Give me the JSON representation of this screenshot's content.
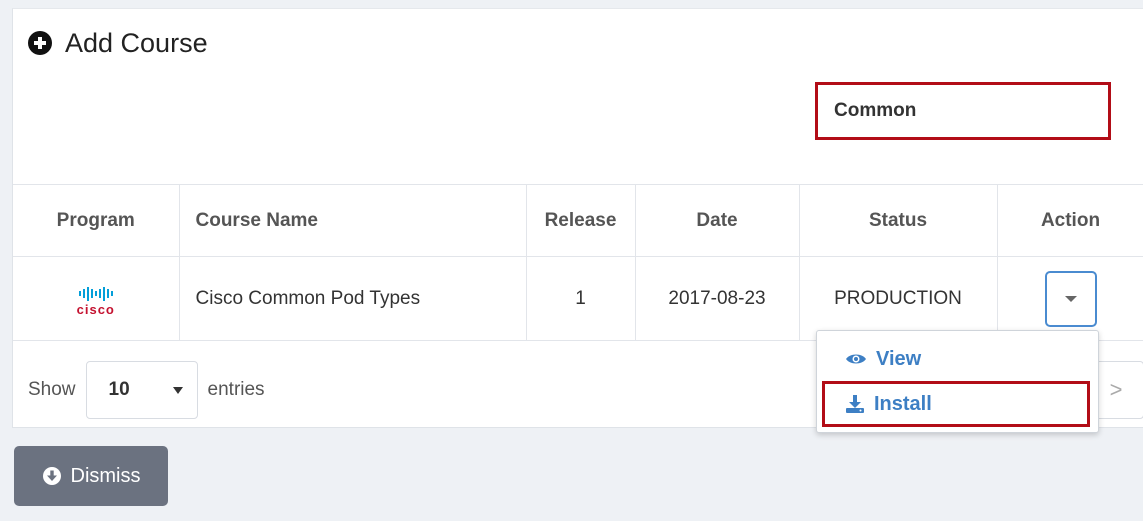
{
  "panel": {
    "title": "Add Course",
    "search": {
      "value": "Common",
      "placeholder": ""
    }
  },
  "table": {
    "headers": [
      "Program",
      "Course Name",
      "Release",
      "Date",
      "Status",
      "Action"
    ],
    "rows": [
      {
        "program_logo": "cisco",
        "course_name": "Cisco Common Pod Types",
        "release": "1",
        "date": "2017-08-23",
        "status": "PRODUCTION"
      }
    ]
  },
  "footer": {
    "show_label": "Show",
    "entries_value": "10",
    "entries_label": "entries",
    "next_label": ">"
  },
  "action_menu": {
    "items": [
      {
        "label": "View",
        "icon": "eye-icon"
      },
      {
        "label": "Install",
        "icon": "download-icon"
      }
    ]
  },
  "dismiss": {
    "label": "Dismiss",
    "icon": "circle-arrow-down-icon"
  },
  "colors": {
    "accent_blue": "#3d7fc4",
    "highlight_red": "#b20d17",
    "cisco_blue": "#049fd9",
    "cisco_red": "#c41230",
    "dismiss_gray": "#6b7280"
  }
}
